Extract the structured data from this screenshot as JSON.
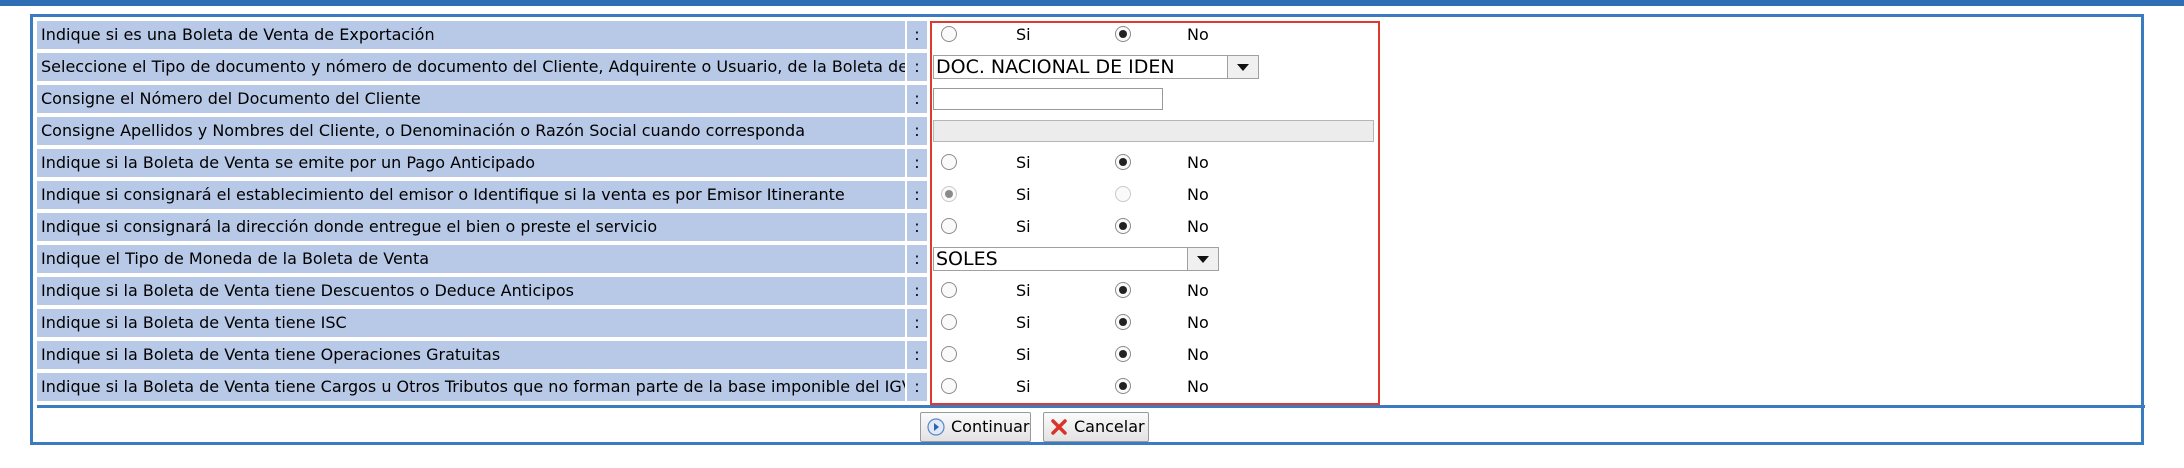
{
  "form": {
    "separator": ":",
    "si_label": "Si",
    "no_label": "No",
    "rows": [
      {
        "label": "Indique si es una Boleta de Venta de Exportación",
        "type": "radio",
        "selected": "No"
      },
      {
        "label": "Seleccione el Tipo de documento y nómero de documento del Cliente, Adquirente o Usuario, de la Boleta de Venta",
        "type": "select",
        "value": "DOC. NACIONAL DE IDEN"
      },
      {
        "label": "Consigne el Nómero del Documento del Cliente",
        "type": "text",
        "value": ""
      },
      {
        "label": "Consigne Apellidos y Nombres del Cliente, o Denominación o Razón Social cuando corresponda",
        "type": "text-disabled",
        "value": ""
      },
      {
        "label": "Indique si la Boleta de Venta se emite por un Pago Anticipado",
        "type": "radio",
        "selected": "No"
      },
      {
        "label": "Indique si consignará el establecimiento del emisor o Identifique si la venta es por Emisor Itinerante",
        "type": "radio-disabled",
        "selected": "Si"
      },
      {
        "label": "Indique si consignará la dirección donde entregue el bien o preste el servicio",
        "type": "radio",
        "selected": "No"
      },
      {
        "label": "Indique el Tipo de Moneda de la Boleta de Venta",
        "type": "select",
        "value": "SOLES"
      },
      {
        "label": "Indique si la Boleta de Venta tiene Descuentos o Deduce Anticipos",
        "type": "radio",
        "selected": "No"
      },
      {
        "label": "Indique si la Boleta de Venta tiene ISC",
        "type": "radio",
        "selected": "No"
      },
      {
        "label": "Indique si la Boleta de Venta tiene Operaciones Gratuitas",
        "type": "radio",
        "selected": "No"
      },
      {
        "label": "Indique si la Boleta de Venta tiene Cargos u Otros Tributos que no forman parte de la base imponible del IGV",
        "type": "radio",
        "selected": "No"
      }
    ]
  },
  "buttons": {
    "continuar": "Continuar",
    "cancelar": "Cancelar"
  },
  "colors": {
    "label_bg": "#b8c9e8",
    "border_blue": "#3b7bbf",
    "highlight_red": "#e0392d"
  }
}
